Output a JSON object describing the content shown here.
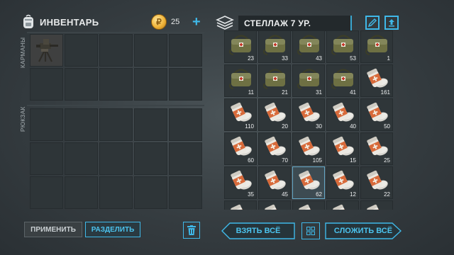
{
  "inventory": {
    "title": "ИНВЕНТАРЬ",
    "coins": "25",
    "pockets_label": "КАРМАНЫ",
    "backpack_label": "РЮКЗАК",
    "first_pocket_item": "turret-icon"
  },
  "storage": {
    "title": "СТЕЛЛАЖ 7 УР.",
    "items": [
      {
        "type": "satchel",
        "qty": "23"
      },
      {
        "type": "satchel",
        "qty": "33"
      },
      {
        "type": "satchel",
        "qty": "43"
      },
      {
        "type": "satchel",
        "qty": "53"
      },
      {
        "type": "satchel",
        "qty": "1"
      },
      {
        "type": "satchel",
        "qty": "11"
      },
      {
        "type": "satchel",
        "qty": "21"
      },
      {
        "type": "satchel",
        "qty": "31"
      },
      {
        "type": "satchel",
        "qty": "41"
      },
      {
        "type": "pills",
        "qty": "161"
      },
      {
        "type": "pills",
        "qty": "110"
      },
      {
        "type": "pills",
        "qty": "20"
      },
      {
        "type": "pills",
        "qty": "30"
      },
      {
        "type": "pills",
        "qty": "40"
      },
      {
        "type": "pills",
        "qty": "50"
      },
      {
        "type": "pills",
        "qty": "60"
      },
      {
        "type": "pills",
        "qty": "70"
      },
      {
        "type": "pills",
        "qty": "105"
      },
      {
        "type": "pills",
        "qty": "15"
      },
      {
        "type": "pills",
        "qty": "25"
      },
      {
        "type": "pills",
        "qty": "35"
      },
      {
        "type": "pills",
        "qty": "45"
      },
      {
        "type": "pills",
        "qty": "62",
        "selected": true
      },
      {
        "type": "pills",
        "qty": "12"
      },
      {
        "type": "pills",
        "qty": "22"
      },
      {
        "type": "pills",
        "qty": ""
      },
      {
        "type": "pills",
        "qty": ""
      },
      {
        "type": "pills",
        "qty": ""
      },
      {
        "type": "pills",
        "qty": ""
      },
      {
        "type": "pills",
        "qty": ""
      }
    ]
  },
  "buttons": {
    "apply": "ПРИМЕНИТЬ",
    "split": "РАЗДЕЛИТЬ",
    "take_all": "ВЗЯТЬ ВСЁ",
    "store_all": "СЛОЖИТЬ ВСЁ"
  },
  "colors": {
    "accent": "#3fb8e8",
    "panel": "#2e3538"
  }
}
